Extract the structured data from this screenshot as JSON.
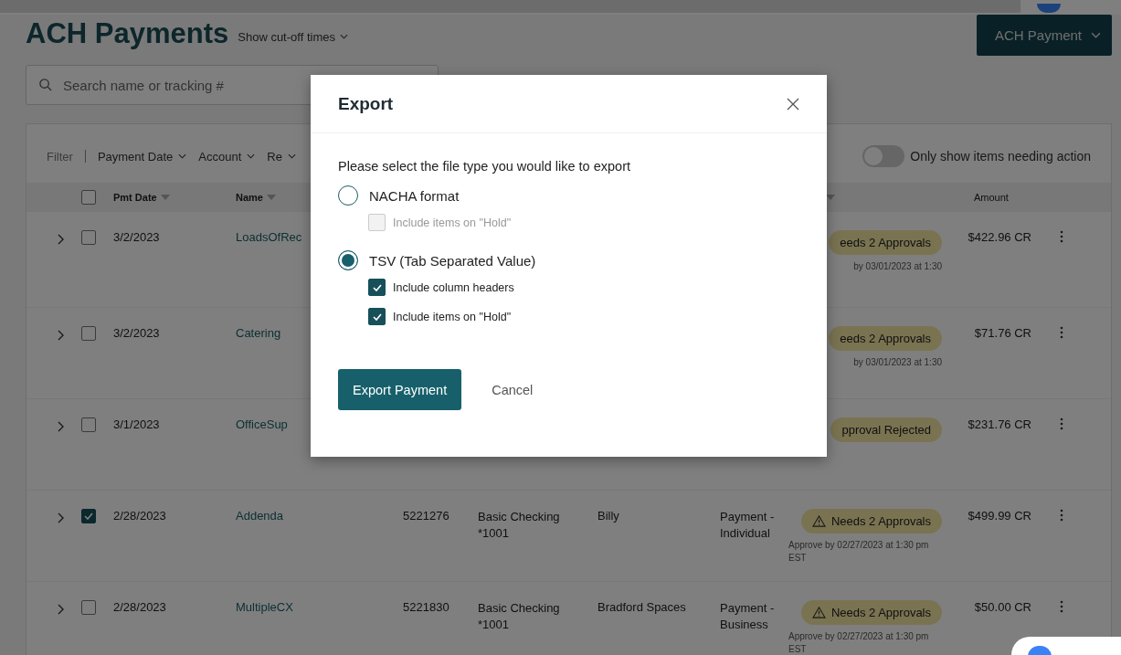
{
  "page": {
    "title": "ACH Payments",
    "cutoff_link": "Show cut-off times",
    "new_button": "ACH Payment"
  },
  "search": {
    "placeholder": "Search name or tracking #"
  },
  "filters": {
    "label": "Filter",
    "items": [
      "Payment Date",
      "Account",
      "Re"
    ]
  },
  "action_toggle": {
    "label": "Only show items needing action",
    "on": false
  },
  "table": {
    "header_checked": false,
    "columns": [
      {
        "label": "Pmt Date",
        "sortable": true
      },
      {
        "label": "Name",
        "sortable": true
      },
      {
        "sortable": true
      },
      {
        "label": "Amount",
        "sortable": false
      }
    ],
    "rows": [
      {
        "selected": false,
        "date": "3/2/2023",
        "name": "LoadsOfRec",
        "status": {
          "label": "eeds 2 Approvals",
          "warning_icon": false,
          "note": "by 03/01/2023 at 1:30"
        },
        "amount": "$422.96 CR"
      },
      {
        "selected": false,
        "date": "3/2/2023",
        "name": "Catering",
        "status": {
          "label": "eeds 2 Approvals",
          "warning_icon": false,
          "note": "by 03/01/2023 at 1:30"
        },
        "amount": "$71.76 CR"
      },
      {
        "selected": false,
        "date": "3/1/2023",
        "name": "OfficeSup",
        "status": {
          "label": "pproval Rejected",
          "warning_icon": false
        },
        "amount": "$231.76 CR"
      },
      {
        "selected": true,
        "date": "2/28/2023",
        "name": "Addenda",
        "tracking": "5221276",
        "account": "Basic Checking *1001",
        "recipient": "Billy",
        "type": "Payment - Individual",
        "status": {
          "label": "Needs 2 Approvals",
          "warning_icon": true,
          "note": "Approve by 02/27/2023 at 1:30 pm EST"
        },
        "amount": "$499.99 CR"
      },
      {
        "selected": false,
        "date": "2/28/2023",
        "name": "MultipleCX",
        "tracking": "5221830",
        "account": "Basic Checking *1001",
        "recipient": "Bradford Spaces",
        "type": "Payment - Business",
        "status": {
          "label": "Needs 2 Approvals",
          "warning_icon": true,
          "note": "Approve by 02/27/2023 at 1:30 pm EST"
        },
        "amount": "$50.00 CR"
      }
    ]
  },
  "dialog": {
    "title": "Export",
    "prompt": "Please select the file type you would like to export",
    "options": [
      {
        "label": "NACHA format",
        "selected": false,
        "suboptions": [
          {
            "label": "Include items on \"Hold\"",
            "checked": false,
            "disabled": true
          }
        ]
      },
      {
        "label": "TSV (Tab Separated Value)",
        "selected": true,
        "suboptions": [
          {
            "label": "Include column headers",
            "checked": true,
            "disabled": false
          },
          {
            "label": "Include items on \"Hold\"",
            "checked": true,
            "disabled": false
          }
        ]
      }
    ],
    "primary_button": "Export Payment",
    "secondary_button": "Cancel"
  }
}
